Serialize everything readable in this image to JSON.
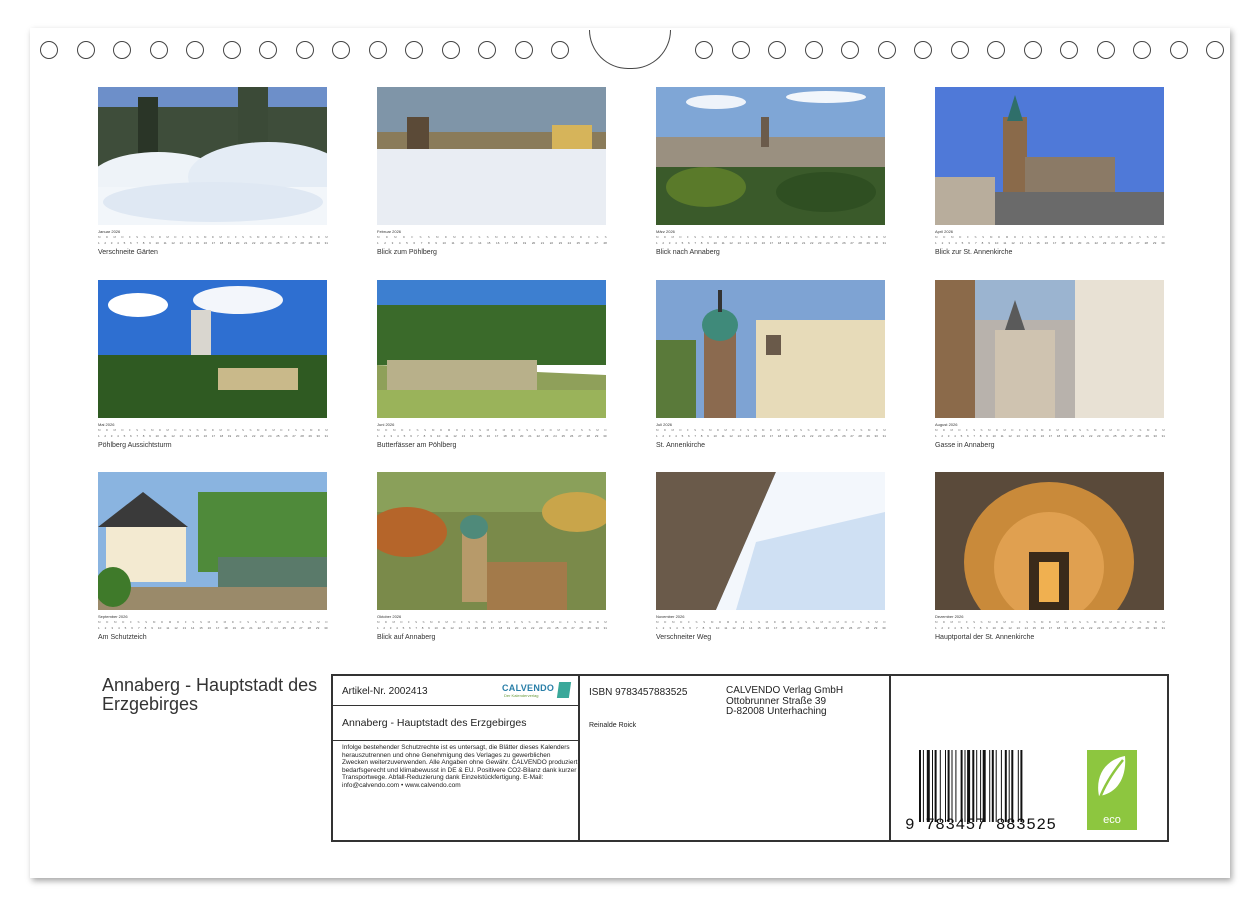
{
  "calendar": {
    "months": [
      {
        "name": "Januar 2026",
        "caption": "Verschneite Gärten",
        "days_in_month": 31,
        "scene": "snow-garden"
      },
      {
        "name": "Februar 2026",
        "caption": "Blick zum Pöhlberg",
        "days_in_month": 28,
        "scene": "snow-field"
      },
      {
        "name": "März 2026",
        "caption": "Blick nach Annaberg",
        "days_in_month": 31,
        "scene": "town-view"
      },
      {
        "name": "April 2026",
        "caption": "Blick zur St. Annenkirche",
        "days_in_month": 30,
        "scene": "church-sky"
      },
      {
        "name": "Mai 2026",
        "caption": "Pöhlberg Aussichtsturm",
        "days_in_month": 31,
        "scene": "tower-clouds"
      },
      {
        "name": "Juni 2026",
        "caption": "Butterfässer am Pöhlberg",
        "days_in_month": 30,
        "scene": "rock-forest"
      },
      {
        "name": "Juli 2026",
        "caption": "St. Annenkirche",
        "days_in_month": 31,
        "scene": "green-dome"
      },
      {
        "name": "August 2026",
        "caption": "Gasse in Annaberg",
        "days_in_month": 31,
        "scene": "alley"
      },
      {
        "name": "September 2026",
        "caption": "Am Schutzteich",
        "days_in_month": 30,
        "scene": "pavilion-pond"
      },
      {
        "name": "Oktober 2026",
        "caption": "Blick auf Annaberg",
        "days_in_month": 31,
        "scene": "autumn-town"
      },
      {
        "name": "November 2026",
        "caption": "Verschneiter Weg",
        "days_in_month": 30,
        "scene": "snow-fence"
      },
      {
        "name": "Dezember 2026",
        "caption": "Hauptportal der St. Annenkirche",
        "days_in_month": 31,
        "scene": "portal-night"
      }
    ],
    "weekday_letters": [
      "M",
      "D",
      "M",
      "D",
      "F",
      "S",
      "S"
    ]
  },
  "cover": {
    "title": "Annaberg - Hauptstadt des Erzgebirges"
  },
  "info": {
    "article_number": "Artikel-Nr. 2002413",
    "book_title": "Annaberg - Hauptstadt des Erzgebirges",
    "legal_text": "Infolge bestehender Schutzrechte ist es untersagt, die Blätter dieses Kalenders herauszutrennen und ohne Genehmigung des Verlages zu gewerblichen Zwecken weiterzuverwenden. Alle Angaben ohne Gewähr. CALVENDO produziert bedarfsgerecht und klimabewusst in DE & EU. Positivere CO2-Bilanz dank kurzer Transportwege. Abfall-Reduzierung dank Einzelstückfertigung. E-Mail: info@calvendo.com • www.calvendo.com",
    "isbn": "ISBN 9783457883525",
    "author": "Reinalde Roick",
    "publisher_line1": "CALVENDO Verlag GmbH",
    "publisher_line2": "Ottobrunner Straße 39",
    "publisher_line3": "D-82008 Unterhaching",
    "barcode_number": "9 783457 883525",
    "logo_text": "CALVENDO",
    "logo_tagline": "Der Kalenderverlag",
    "eco_label": "eco"
  }
}
